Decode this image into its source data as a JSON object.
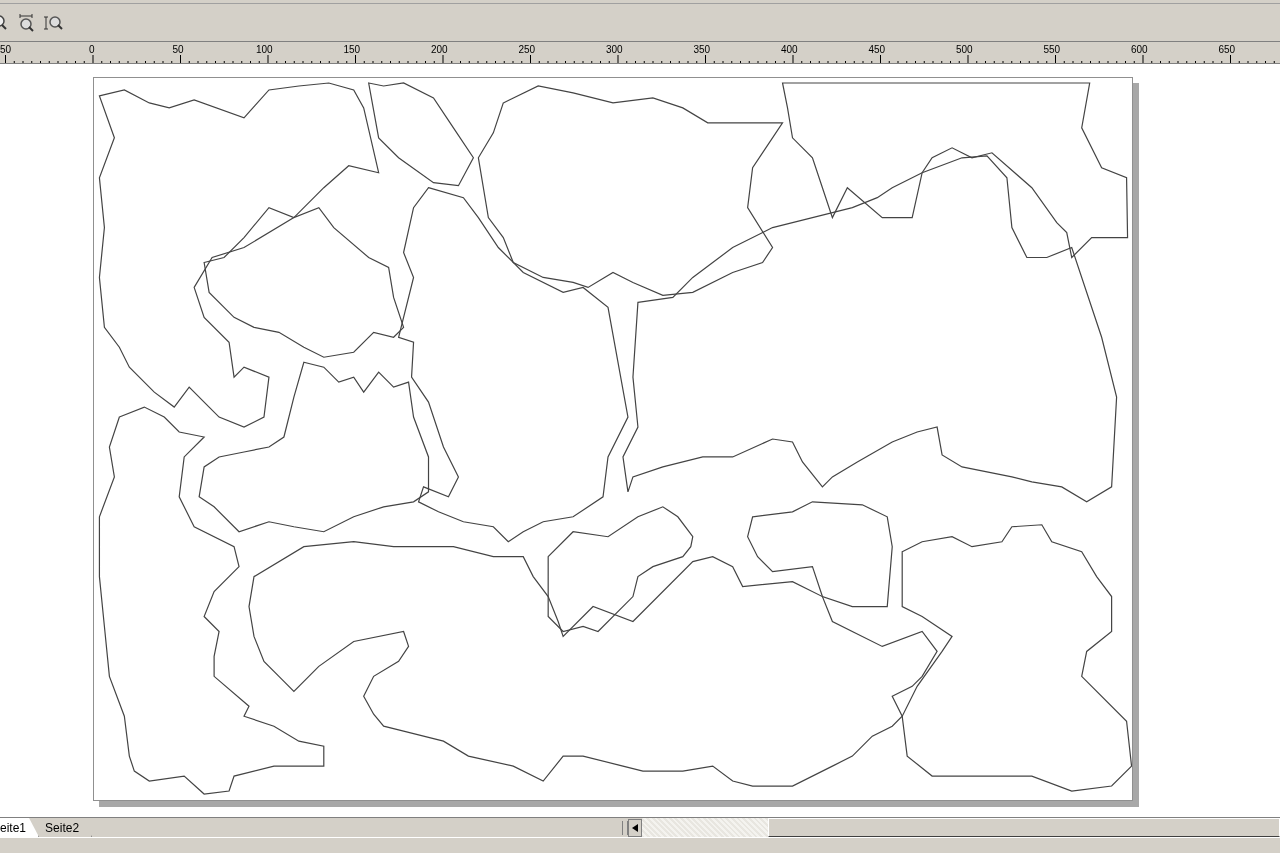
{
  "toolbar": {
    "icons": [
      {
        "kind": "zoom"
      },
      {
        "kind": "zoom-width"
      },
      {
        "kind": "zoom-height"
      }
    ]
  },
  "ruler": {
    "labels": [
      "50",
      "0",
      "50",
      "100",
      "150",
      "200",
      "250",
      "300",
      "350",
      "400",
      "450",
      "500",
      "550",
      "600",
      "650"
    ]
  },
  "page_tabs": [
    {
      "label": "eite1",
      "selected": true
    },
    {
      "label": "Seite2",
      "selected": false
    }
  ]
}
